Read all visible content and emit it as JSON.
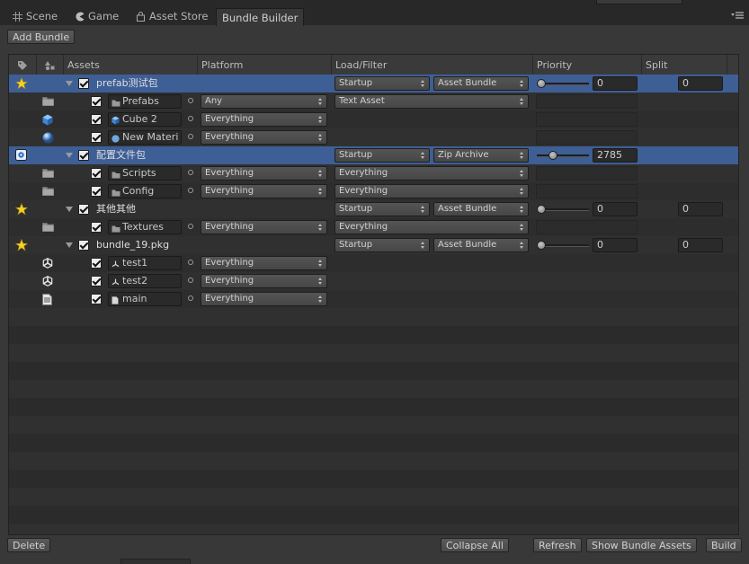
{
  "tabs": [
    {
      "label": "Scene",
      "icon": "grid-icon",
      "active": false
    },
    {
      "label": "Game",
      "icon": "pacman-icon",
      "active": false
    },
    {
      "label": "Asset Store",
      "icon": "shopping-bag-icon",
      "active": false
    },
    {
      "label": "Bundle Builder",
      "icon": "",
      "active": true
    }
  ],
  "toolbar": {
    "add_bundle": "Add Bundle"
  },
  "columns": {
    "type_icon": "tag-icon",
    "state_icon": "shapes-icon",
    "assets": "Assets",
    "platform": "Platform",
    "load_filter": "Load/Filter",
    "priority": "Priority",
    "split": "Split"
  },
  "rows": [
    {
      "kind": "bundle",
      "selected": true,
      "icon": "star-icon",
      "name": "prefab测试包",
      "load": "Startup",
      "type": "Asset Bundle",
      "priority_fraction": 0.0,
      "priority": "0",
      "split": "0"
    },
    {
      "kind": "asset",
      "icon": "folder-icon",
      "field_icon": "folder-icon",
      "name": "Prefabs",
      "platform": "Any",
      "filter": "Text Asset"
    },
    {
      "kind": "asset",
      "icon": "cube-icon",
      "field_icon": "cube-icon",
      "name": "Cube 2",
      "platform": "Everything",
      "filter": ""
    },
    {
      "kind": "asset",
      "icon": "sphere-icon",
      "field_icon": "sphere-icon",
      "name": "New Materi",
      "platform": "Everything",
      "filter": ""
    },
    {
      "kind": "bundle",
      "selected": true,
      "icon": "zip-icon",
      "name": "配置文件包",
      "load": "Startup",
      "type": "Zip Archive",
      "priority_fraction": 0.28,
      "priority": "2785",
      "split": ""
    },
    {
      "kind": "asset",
      "icon": "folder-icon",
      "field_icon": "folder-icon",
      "name": "Scripts",
      "platform": "Everything",
      "filter": "Everything"
    },
    {
      "kind": "asset",
      "icon": "folder-icon",
      "field_icon": "folder-icon",
      "name": "Config",
      "platform": "Everything",
      "filter": "Everything"
    },
    {
      "kind": "bundle",
      "selected": false,
      "icon": "star-icon",
      "name": "其他其他",
      "load": "Startup",
      "type": "Asset Bundle",
      "priority_fraction": 0.0,
      "priority": "0",
      "split": "0"
    },
    {
      "kind": "asset",
      "icon": "folder-icon",
      "field_icon": "folder-icon",
      "name": "Textures",
      "platform": "Everything",
      "filter": "Everything"
    },
    {
      "kind": "bundle",
      "selected": false,
      "icon": "star-icon",
      "name": "bundle_19.pkg",
      "load": "Startup",
      "type": "Asset Bundle",
      "priority_fraction": 0.0,
      "priority": "0",
      "split": "0"
    },
    {
      "kind": "asset",
      "icon": "unity-icon",
      "field_icon": "unity-icon",
      "name": "test1",
      "platform": "Everything",
      "filter": null
    },
    {
      "kind": "asset",
      "icon": "unity-icon",
      "field_icon": "unity-icon",
      "name": "test2",
      "platform": "Everything",
      "filter": null
    },
    {
      "kind": "asset",
      "icon": "text-file-icon",
      "field_icon": "text-file-icon",
      "name": "main",
      "platform": "Everything",
      "filter": null
    }
  ],
  "footer": {
    "delete": "Delete",
    "collapse_all": "Collapse All",
    "refresh": "Refresh",
    "show_bundle_assets": "Show Bundle Assets",
    "build": "Build"
  },
  "colors": {
    "selection": "#3e5f96",
    "star": "#f5d22a",
    "window_bg": "#383838",
    "grid_bg": "#2b2b2b"
  }
}
